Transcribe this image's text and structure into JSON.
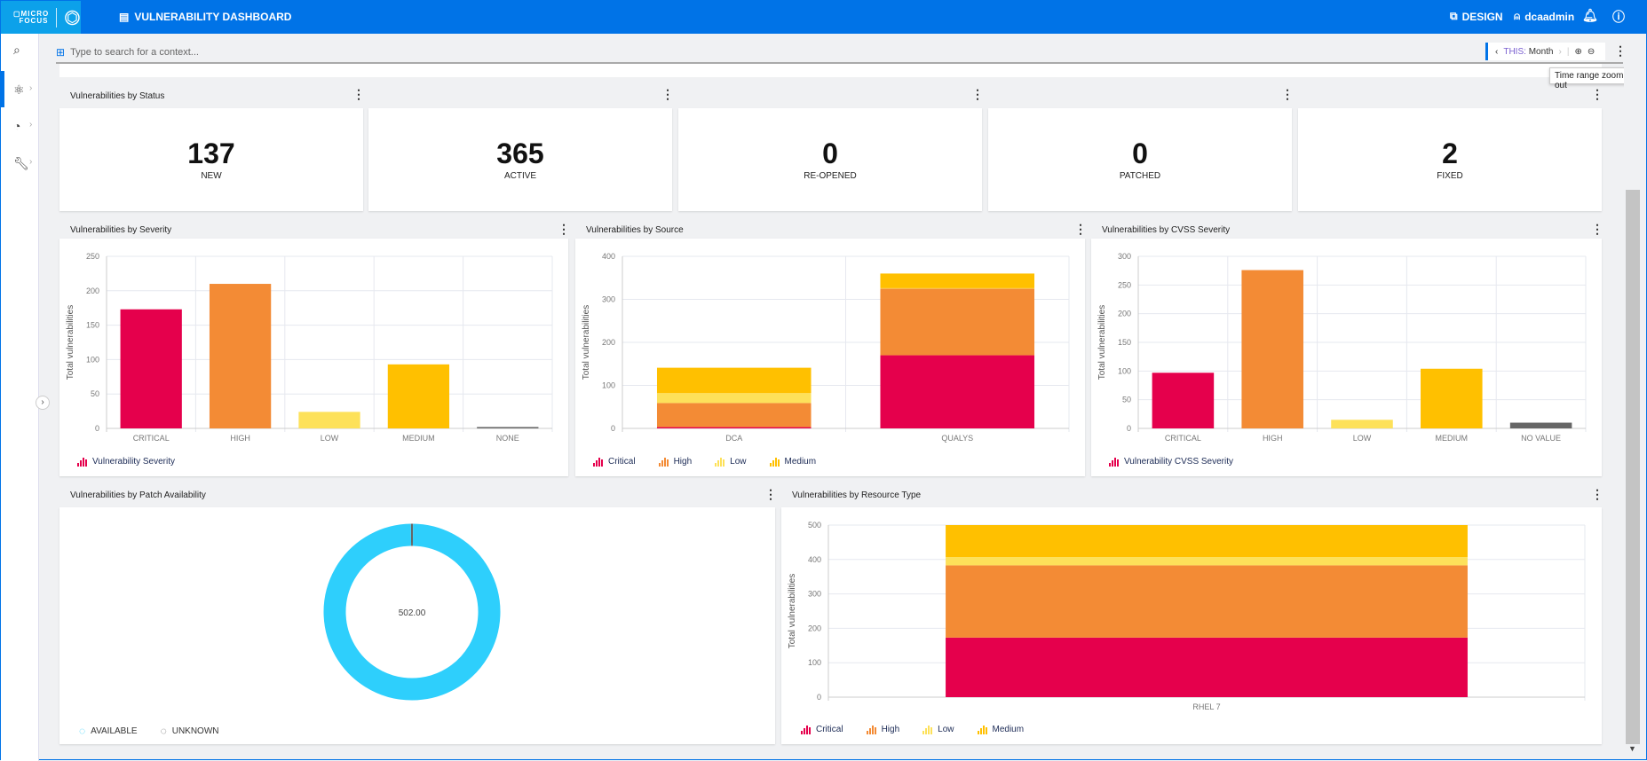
{
  "header": {
    "logo_text": "MICRO FOCUS",
    "title": "VULNERABILITY DASHBOARD",
    "design": "DESIGN",
    "user": "dcaadmin"
  },
  "search": {
    "placeholder": "Type to search for a context..."
  },
  "time_range": {
    "prefix": "THIS:",
    "value": "Month"
  },
  "tooltip": "Time range zoom out",
  "status_panel": {
    "title": "Vulnerabilities by Status",
    "cards": [
      {
        "value": "137",
        "label": "NEW"
      },
      {
        "value": "365",
        "label": "ACTIVE"
      },
      {
        "value": "0",
        "label": "RE-OPENED"
      },
      {
        "value": "0",
        "label": "PATCHED"
      },
      {
        "value": "2",
        "label": "FIXED"
      }
    ]
  },
  "colors": {
    "critical": "#e5004c",
    "high": "#f38b35",
    "low": "#fde15a",
    "medium": "#ffc000",
    "none": "#666666",
    "available": "#2ecffc",
    "unknown": "#666666",
    "header": "#0073e7"
  },
  "chart_data": [
    {
      "type": "bar",
      "title": "Vulnerabilities by Severity",
      "ylabel": "Total vulnerabilities",
      "ylim": [
        0,
        250
      ],
      "yticks": [
        0,
        50,
        100,
        150,
        200,
        250
      ],
      "categories": [
        "CRITICAL",
        "HIGH",
        "LOW",
        "MEDIUM",
        "NONE"
      ],
      "values": [
        173,
        210,
        24,
        93,
        2
      ],
      "bar_colors": [
        "#e5004c",
        "#f38b35",
        "#fde15a",
        "#ffc000",
        "#666666"
      ],
      "legend": [
        {
          "name": "Vulnerability Severity",
          "color": "#e5004c"
        }
      ]
    },
    {
      "type": "bar",
      "stacked": true,
      "title": "Vulnerabilities by Source",
      "ylabel": "Total vulnerabilities",
      "ylim": [
        0,
        400
      ],
      "yticks": [
        0,
        100,
        200,
        300,
        400
      ],
      "categories": [
        "DCA",
        "QUALYS"
      ],
      "series": [
        {
          "name": "Critical",
          "color": "#e5004c",
          "values": [
            3,
            170
          ]
        },
        {
          "name": "High",
          "color": "#f38b35",
          "values": [
            56,
            155
          ]
        },
        {
          "name": "Low",
          "color": "#fde15a",
          "values": [
            23,
            1
          ]
        },
        {
          "name": "Medium",
          "color": "#ffc000",
          "values": [
            59,
            34
          ]
        }
      ]
    },
    {
      "type": "bar",
      "title": "Vulnerabilities by CVSS Severity",
      "ylabel": "Total vulnerabilities",
      "ylim": [
        0,
        300
      ],
      "yticks": [
        0,
        50,
        100,
        150,
        200,
        250,
        300
      ],
      "categories": [
        "CRITICAL",
        "HIGH",
        "LOW",
        "MEDIUM",
        "NO VALUE"
      ],
      "values": [
        97,
        276,
        15,
        104,
        10
      ],
      "bar_colors": [
        "#e5004c",
        "#f38b35",
        "#fde15a",
        "#ffc000",
        "#666666"
      ],
      "legend": [
        {
          "name": "Vulnerability CVSS Severity",
          "color": "#e5004c"
        }
      ]
    },
    {
      "type": "pie",
      "donut": true,
      "title": "Vulnerabilities by Patch Availability",
      "center_label": "502.00",
      "slices": [
        {
          "name": "AVAILABLE",
          "value": 500,
          "color": "#2ecffc"
        },
        {
          "name": "UNKNOWN",
          "value": 2,
          "color": "#666666"
        }
      ]
    },
    {
      "type": "bar",
      "stacked": true,
      "title": "Vulnerabilities by Resource Type",
      "ylabel": "Total vulnerabilities",
      "ylim": [
        0,
        500
      ],
      "yticks": [
        0,
        100,
        200,
        300,
        400,
        500
      ],
      "categories": [
        "RHEL 7"
      ],
      "series": [
        {
          "name": "Critical",
          "color": "#e5004c",
          "values": [
            173
          ]
        },
        {
          "name": "High",
          "color": "#f38b35",
          "values": [
            210
          ]
        },
        {
          "name": "Low",
          "color": "#fde15a",
          "values": [
            24
          ]
        },
        {
          "name": "Medium",
          "color": "#ffc000",
          "values": [
            93
          ]
        }
      ]
    }
  ]
}
